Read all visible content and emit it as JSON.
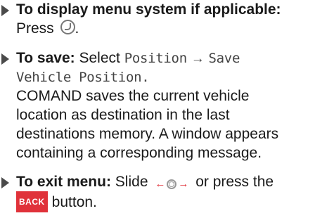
{
  "steps": [
    {
      "heading": "To display menu system if applicable:",
      "text_before": "Press",
      "text_after": "."
    },
    {
      "heading": "To save:",
      "select_word": "Select",
      "menu_path_1": "Position",
      "arrow_symbol": "→",
      "menu_path_2": "Save",
      "menu_path_3": "Vehicle Position.",
      "body_lines": [
        "COMAND saves the current vehicle",
        "location as destination in the last",
        "destinations memory. A window appears",
        "containing a corresponding message."
      ]
    },
    {
      "heading": "To exit menu:",
      "text_before": "Slide",
      "text_middle": "or press the",
      "back_label": "BACK",
      "text_after": "button."
    }
  ],
  "icons": {
    "press_control": "controller-press-icon",
    "slide_control": "controller-slide-left-right-icon",
    "bullet": "bullet-arrow-icon"
  },
  "colors": {
    "accent_red": "#e0323a",
    "text": "#1a1a1a"
  }
}
